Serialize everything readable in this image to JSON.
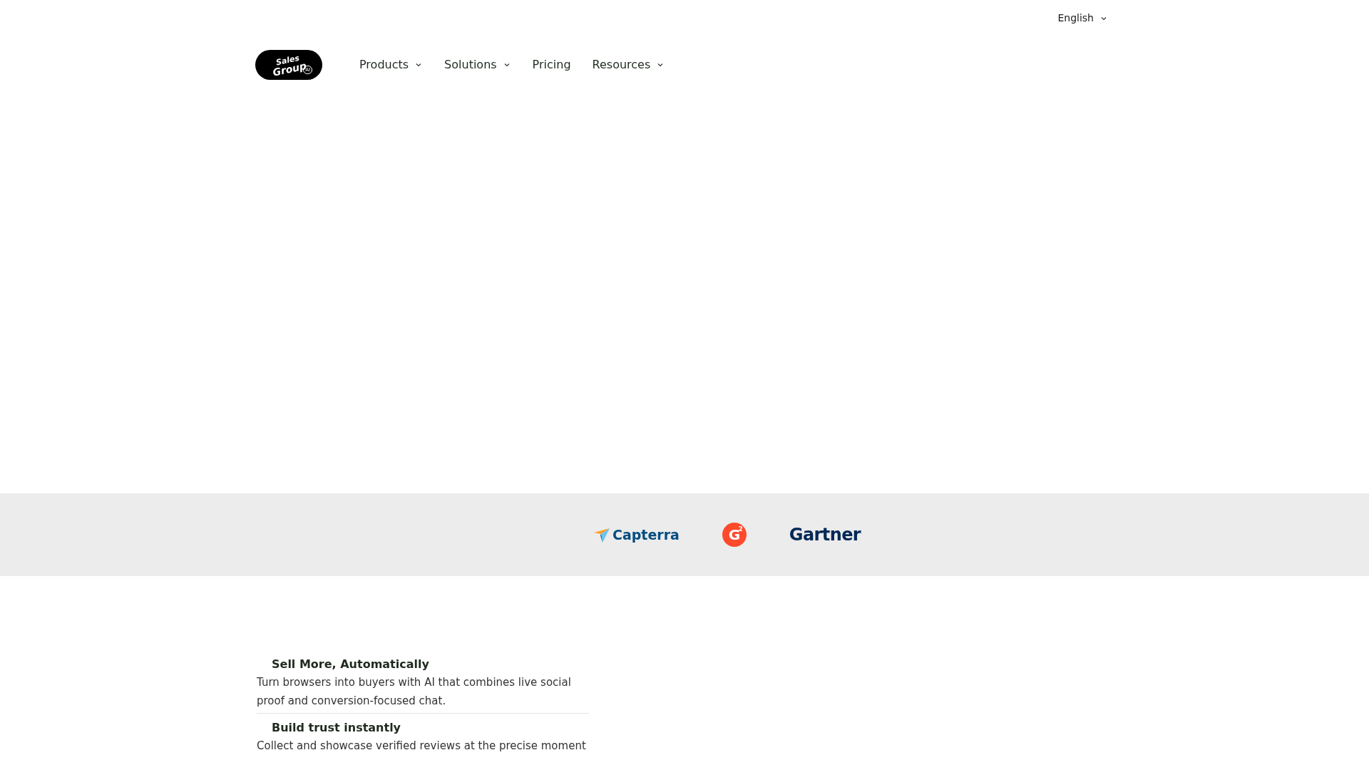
{
  "language_selector": {
    "label": "English"
  },
  "logo": {
    "line_1": "Sales",
    "line_2": "Group",
    "badge": "AI"
  },
  "nav": [
    {
      "label": "Products",
      "has_menu": true
    },
    {
      "label": "Solutions",
      "has_menu": true
    },
    {
      "label": "Pricing",
      "has_menu": false
    },
    {
      "label": "Resources",
      "has_menu": true
    }
  ],
  "review_logos": [
    {
      "kind": "capterra",
      "label": "Capterra"
    },
    {
      "kind": "g2",
      "label": "G",
      "superscript": "2"
    },
    {
      "kind": "gartner",
      "label": "Gartner"
    }
  ],
  "features": [
    {
      "title": "Sell More, Automatically",
      "description": "Turn browsers into buyers with AI that combines live social proof and conversion-focused chat."
    },
    {
      "title": "Build trust instantly",
      "description": "Collect and showcase verified reviews at the precise moment"
    }
  ]
}
